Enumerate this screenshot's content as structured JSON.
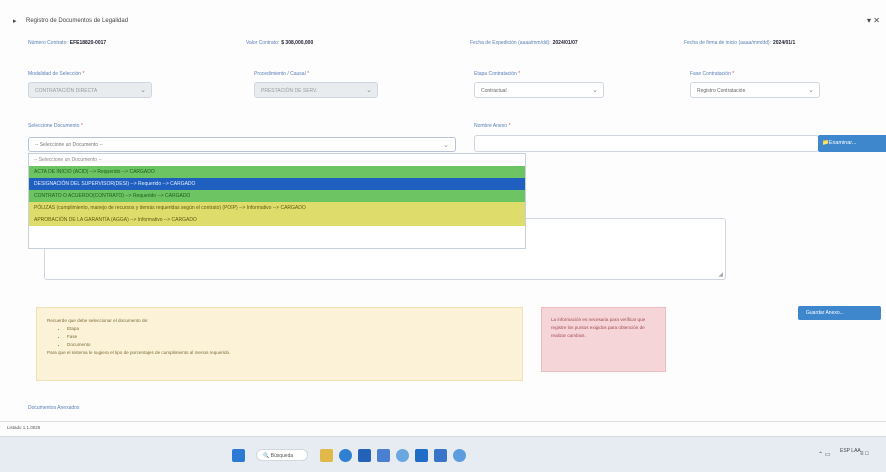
{
  "window": {
    "title": "Registro de Documentos de Legalidad",
    "maximize_glyph": "▾ ✕"
  },
  "info_row": [
    {
      "label": "Número Contrato:",
      "value": "EFE18820-0017"
    },
    {
      "label": "Valor Contrato:",
      "value": "$ 308,000,000"
    },
    {
      "label": "Fecha de Expedición (aaaa/mm/dd):",
      "value": "2024/01/07"
    },
    {
      "label": "Fecha de firma de inicio (aaaa/mm/dd):",
      "value": "2024/01/1"
    }
  ],
  "filters": [
    {
      "label": "Modalidad de Selección",
      "value": "CONTRATACIÓN DIRECTA",
      "disabled": true
    },
    {
      "label": "Procedimiento / Causal",
      "value": "PRESTACIÓN DE SERV.",
      "disabled": true
    },
    {
      "label": "Etapa Contratación",
      "value": "Contractual",
      "disabled": false
    },
    {
      "label": "Fase Contratación",
      "value": "Registro Contratación",
      "disabled": false
    }
  ],
  "document": {
    "label": "Seleccione Documento",
    "placeholder": "-- Seleccione un Documento --",
    "name_label": "Nombre Anexo",
    "examine_button": "Examinar..."
  },
  "dropdown_options": [
    {
      "text": "-- Seleccione un Documento --",
      "kind": "ph"
    },
    {
      "text": "ACTA DE INICIO (ACID) --> Requerido --> CARGADO",
      "kind": "g"
    },
    {
      "text": "DESIGNACIÓN DEL SUPERVISOR(DESI) --> Requerido --> CARGADO",
      "kind": "b"
    },
    {
      "text": "CONTRATO O ACUERDO(CONTRATO) --> Requerido --> CARGADO",
      "kind": "g"
    },
    {
      "text": "PÓLIZAS (cumplimiento, manejo de recursos y demás requeridas según el contrato) (POIP) --> Informativo --> CARGADO",
      "kind": "y"
    },
    {
      "text": "APROBACIÓN DE LA GARANTÍA (AGGA) --> Informativo --> CARGADO",
      "kind": "y"
    }
  ],
  "yellow_box": {
    "intro": "Recuerde que debe seleccionar el documento de:",
    "items": [
      "Etapa",
      "Fase",
      "Documento"
    ],
    "outro": "Para que el sistema le sugiera el tipo de porcentajes de cumplimiento al menos requerido."
  },
  "pink_box": "La información es necesaria para verificar que registre los puntos exigidos para obtención de realizar cambios.",
  "right_button": "Guardar Anexo...",
  "bottom_label": "Documentos Anexados",
  "status_text": "Listado 1.1.0025",
  "taskbar": {
    "search": "Búsqueda",
    "tray_lang": "ESP\nLAA",
    "tray_time": "≡ □"
  }
}
